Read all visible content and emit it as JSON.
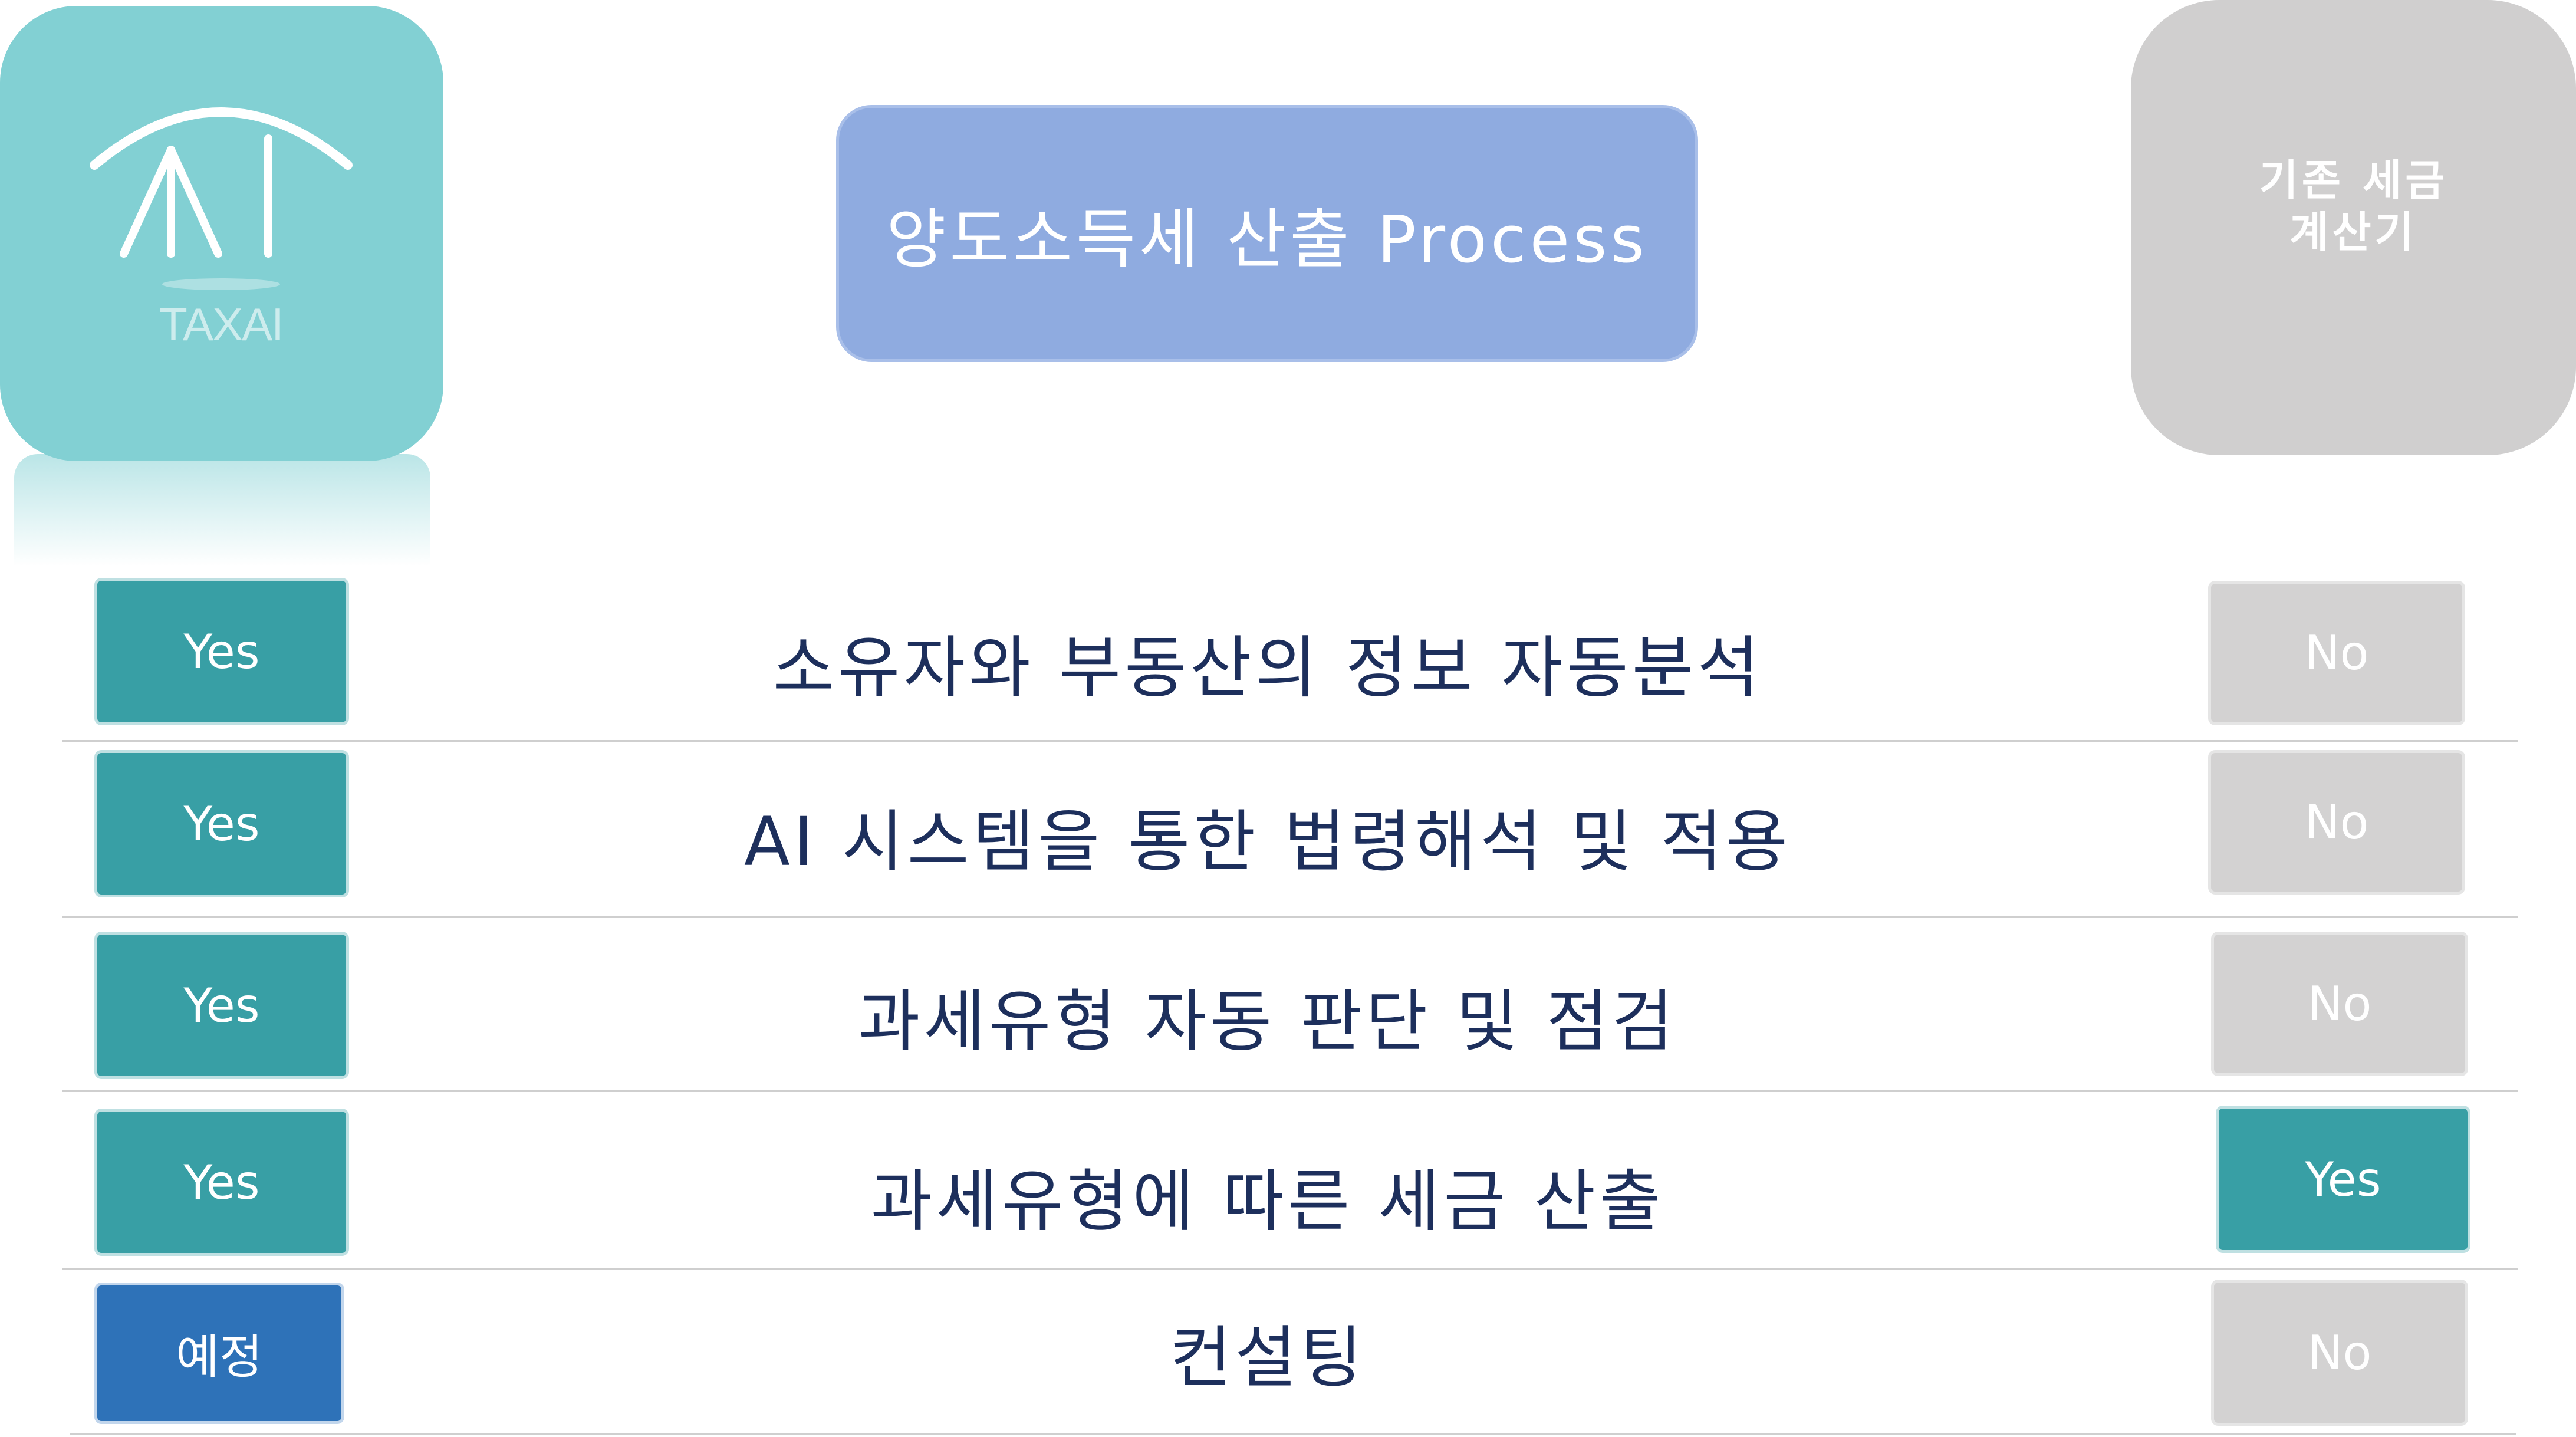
{
  "logo": {
    "text": "TAXAI"
  },
  "title": "양도소득세 산출 Process",
  "existing_calculator": {
    "line1": "기존 세금",
    "line2": "계산기"
  },
  "rows": [
    {
      "label": "소유자와 부동산의 정보 자동분석",
      "taxai": "Yes",
      "existing": "No"
    },
    {
      "label": "AI 시스템을 통한 법령해석 및 적용",
      "taxai": "Yes",
      "existing": "No"
    },
    {
      "label": "과세유형 자동 판단 및 점검",
      "taxai": "Yes",
      "existing": "No"
    },
    {
      "label": "과세유형에 따른 세금 산출",
      "taxai": "Yes",
      "existing": "Yes"
    },
    {
      "label": "컨설팅",
      "taxai": "예정",
      "existing": "No"
    }
  ],
  "colors": {
    "logo_bg": "#82d0d3",
    "title_bg": "#8fabe0",
    "calc_bg": "#d0cfcf",
    "yes": "#389fa5",
    "planned": "#2e72b8",
    "no": "#d3d2d2",
    "label_text": "#1d2f5c"
  }
}
